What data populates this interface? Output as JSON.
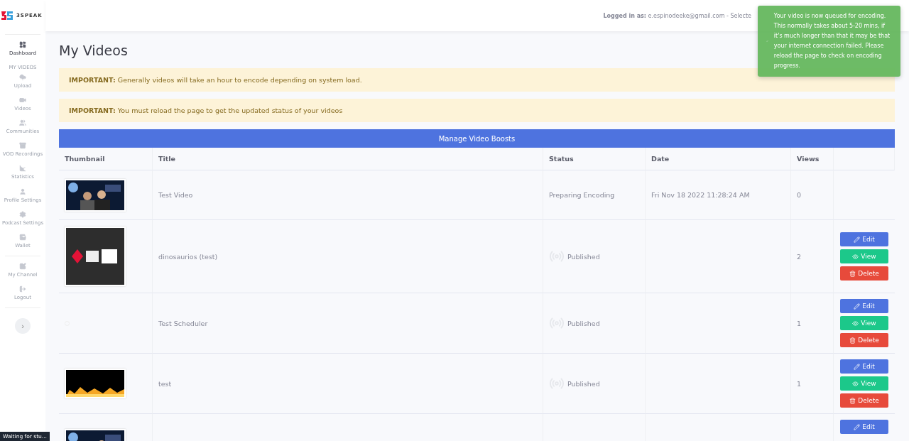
{
  "brand": {
    "name": "3SPEAK"
  },
  "sidebar": {
    "items": [
      {
        "label": "Dashboard",
        "selected": true,
        "kind": "item"
      },
      {
        "label": "MY VIDEOS",
        "kind": "heading"
      },
      {
        "label": "Upload",
        "selected": false,
        "kind": "item"
      },
      {
        "label": "Videos",
        "selected": false,
        "kind": "item"
      },
      {
        "label": "Communities",
        "selected": false,
        "kind": "item"
      },
      {
        "label": "VOD Recordings",
        "selected": false,
        "kind": "item"
      },
      {
        "label": "Statistics",
        "selected": false,
        "kind": "item"
      },
      {
        "label": "Profile Settings",
        "selected": false,
        "kind": "item"
      },
      {
        "label": "Podcast Settings",
        "selected": false,
        "kind": "item"
      },
      {
        "label": "Wallet",
        "selected": false,
        "kind": "item"
      },
      {
        "label": "My Channel",
        "selected": false,
        "kind": "divider-item"
      },
      {
        "label": "Logout",
        "selected": false,
        "kind": "item"
      }
    ],
    "toggle": "›"
  },
  "header": {
    "logged_in_label": "Logged in as:",
    "account": "e.espinodeeke@gmail.com - Selecte"
  },
  "toast": {
    "message": "Your video is now queued for encoding. This normally takes about 5-20 mins, if it's much longer than that it may be that your internet connection failed. Please reload the page to check on encoding progress."
  },
  "page_title": "My Videos",
  "alerts": [
    {
      "label": "IMPORTANT:",
      "text": "Generally videos will take an hour to encode depending on system load."
    },
    {
      "label": "IMPORTANT:",
      "text": "You must reload the page to get the updated status of your videos"
    }
  ],
  "boost_button": "Manage Video Boosts",
  "table": {
    "columns": [
      "Thumbnail",
      "Title",
      "Status",
      "Date",
      "Views"
    ],
    "rows": [
      {
        "thumbnail": {
          "kind": "picture"
        },
        "title": "Test Video",
        "status": "Preparing Encoding",
        "kind": "encoding",
        "date": "Fri Nov 18 2022 11:28:24 AM",
        "views": "0",
        "actions": []
      },
      {
        "thumbnail": {
          "kind": "picture"
        },
        "title": "dinosaurios (test)",
        "status": "Published",
        "kind": "published",
        "views": "2",
        "actions": [
          {
            "label": "Edit",
            "kind": "edit"
          },
          {
            "label": "View",
            "kind": "view"
          },
          {
            "label": "Delete",
            "kind": "delete"
          }
        ]
      },
      {
        "title": "Test Scheduler",
        "status": "Published",
        "kind": "published",
        "views": "1",
        "actions": [
          {
            "label": "Edit",
            "kind": "edit"
          },
          {
            "label": "View",
            "kind": "view"
          },
          {
            "label": "Delete",
            "kind": "delete"
          }
        ]
      },
      {
        "thumbnail": {
          "kind": "picture"
        },
        "title": "test",
        "status": "Published",
        "kind": "published",
        "views": "1",
        "actions": [
          {
            "label": "Edit",
            "kind": "edit"
          },
          {
            "label": "View",
            "kind": "view"
          },
          {
            "label": "Delete",
            "kind": "delete"
          }
        ]
      },
      {
        "thumbnail": {
          "kind": "picture"
        },
        "kind": "partial",
        "actions": [
          {
            "label": "Edit",
            "kind": "edit"
          }
        ]
      }
    ]
  },
  "status_bar": "Waiting for stu..."
}
